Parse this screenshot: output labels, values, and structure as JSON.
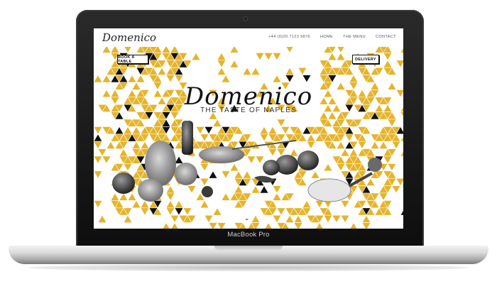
{
  "device": {
    "label": "MacBook Pro"
  },
  "site": {
    "logo_small": "Domenico",
    "nav": [
      "+44 (0)20 7123 9876",
      "HOME",
      "THE MENU",
      "CONTACT"
    ],
    "book_button": "BOOK A TABLE",
    "delivery_button": "DELIVERY",
    "hero_title": "Domenico",
    "tagline": "THE TASTE OF NAPLES",
    "scroll_icon": "chevron-down-icon"
  },
  "colors": {
    "accent": "#e5b42a",
    "dark": "#111111"
  }
}
